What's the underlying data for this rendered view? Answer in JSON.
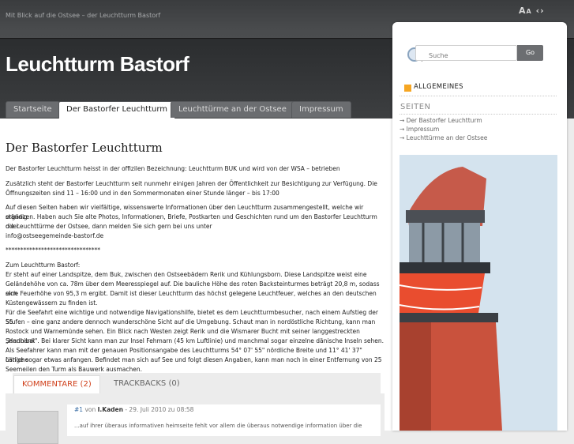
{
  "header": {
    "tagline": "Mit Blick auf die Ostsee – der Leuchtturm Bastorf",
    "font_controls": "AA <>",
    "site_title": "Leuchtturm Bastorf"
  },
  "nav": {
    "tabs": [
      {
        "label": "Startseite",
        "active": false
      },
      {
        "label": "Der Bastorfer Leuchtturm",
        "active": true
      },
      {
        "label": "Leuchttürme an der Ostsee",
        "active": false
      },
      {
        "label": "Impressum",
        "active": false
      }
    ]
  },
  "post": {
    "title": "Der Bastorfer Leuchtturm",
    "p1": "Der Bastorfer Leuchtturm heisst in der offizilen Bezeichnung: Leuchtturm BUK und wird von der WSA – betrieben",
    "p2_l1": "Zusätzlich steht der Bastorfer Leuchtturm seit nunmehr einigen Jahren der Öffentlichkeit zur Besichtigung zur Verfügung. Die",
    "p2_l2": "Öffnungszeiten sind 11 – 16:00 und in den Sommermonaten einer Stunde länger – bis 17:00",
    "p3_l1": "Auf diesen Seiten haben wir vielfältige, wissenswerte Informationen über den Leuchtturm zusammengestellt, welche wir ständig",
    "p3_l2": "ergänzen. Haben auch Sie alte Photos, Informationen, Briefe, Postkarten und Geschichten rund um den Bastorfer Leuchtturm oder",
    "p3_l3": "die Leuchttürme der Ostsee, dann melden Sie sich gern bei uns unter",
    "p3_l4": "info@ostseegemeinde-bastorf.de",
    "stars": "********************************",
    "lines": [
      "Zum Leuchtturm Bastorf:",
      "Er steht auf einer Landspitze, dem Buk, zwischen den Ostseebädern Rerik und Kühlungsborn. Diese Landspitze weist eine",
      "Geländehöhe von ca. 78m über dem Meeresspiegel auf. Die bauliche Höhe des roten Backsteinturmes beträgt 20,8 m, sodass sich",
      "eine Feuerhöhe von 95,3 m ergibt. Damit ist dieser Leuchtturm das höchst gelegene Leuchtfeuer, welches an den deutschen",
      "Küstengewässern zu finden ist.",
      "Für die Seefahrt eine wichtige und notwendige Navigationshilfe, bietet es dem Leuchtturmbesucher, nach einem Aufstieg der 55",
      "Stufen – eine ganz andere dennoch wunderschöne Sicht auf die Umgebung. Schaut man in nordöstliche Richtung, kann man",
      "Rostock und Warnemünde sehen. Ein Blick nach Westen zeigt Rerik und die Wismarer Bucht mit seiner langgestreckten Sandbank",
      "„Hannibal\". Bei klarer Sicht kann man zur Insel Fehmarn (45 km Luftlinie) und manchmal sogar einzelne dänische Inseln sehen.",
      "Als Seefahrer kann man mit der genauen Positionsangabe des Leuchtturms 54° 07' 55\" nördliche Breite und 11° 41' 37\" östliche",
      "Länge sogar etwas anfangen. Befindet man sich auf See und folgt diesen Angaben, kann man noch in einer Entfernung von 25",
      "Seemeilen den Turm als Bauwerk ausmachen."
    ]
  },
  "comments": {
    "tab_comments": "KOMMENTARE (2)",
    "tab_trackbacks": "TRACKBACKS (0)",
    "first": {
      "num": "#1",
      "by": "von",
      "author": "I.Kaden",
      "date": "- 29. Juli 2010 zu 08:58",
      "text": "...auf ihrer überaus informativen heimseite fehlt vor allem die überaus notwendige information über die"
    }
  },
  "sidebar": {
    "search_placeholder": "Suche",
    "search_button": "Go",
    "category": "ALLGEMEINES",
    "seiten_heading": "SEITEN",
    "pages": [
      "Der Bastorfer Leuchtturm",
      "Impressum",
      "Leuchttürme an der Ostsee"
    ]
  },
  "colors": {
    "accent_orange": "#f6a623",
    "active_comment_tab": "#d0401b",
    "header_dark": "#3d3f41"
  }
}
